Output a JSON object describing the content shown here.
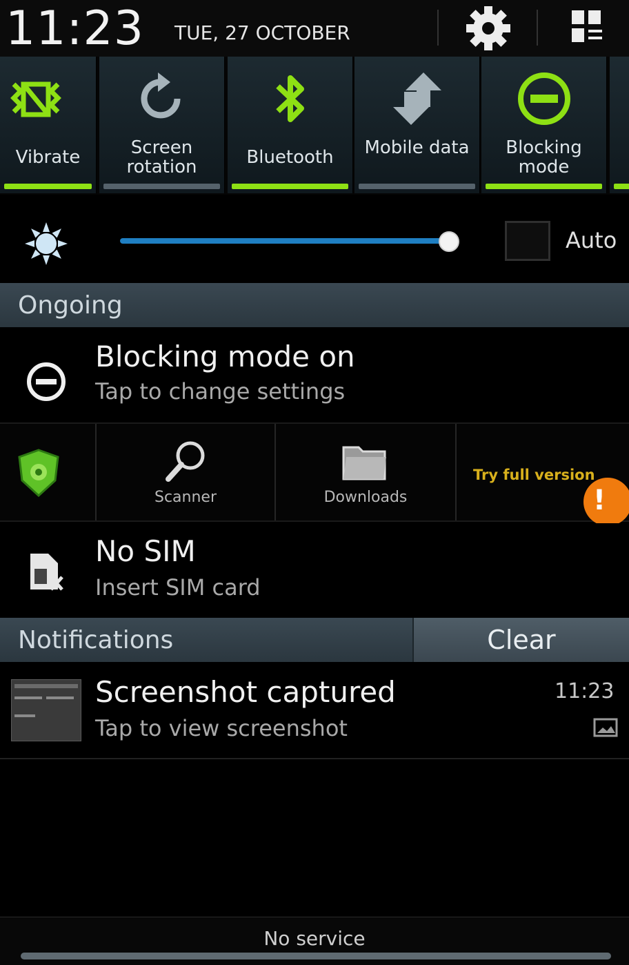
{
  "status": {
    "time": "11:23",
    "date": "TUE, 27 OCTOBER"
  },
  "toggles": [
    {
      "label": "Vibrate",
      "icon": "vibrate-icon",
      "on": true
    },
    {
      "label": "Screen rotation",
      "icon": "rotation-icon",
      "on": false
    },
    {
      "label": "Bluetooth",
      "icon": "bluetooth-icon",
      "on": true
    },
    {
      "label": "Mobile data",
      "icon": "mobile-data-icon",
      "on": false
    },
    {
      "label": "Blocking mode",
      "icon": "blocking-icon",
      "on": true
    }
  ],
  "brightness": {
    "level_fraction": 1.0,
    "auto_label": "Auto",
    "auto_checked": false
  },
  "ongoing": {
    "title": "Ongoing",
    "blocking": {
      "title": "Blocking mode on",
      "subtitle": "Tap to change settings"
    },
    "app_bar": {
      "scanner_label": "Scanner",
      "downloads_label": "Downloads",
      "promo_text": "Try full version",
      "warning_glyph": "!"
    },
    "sim": {
      "title": "No SIM",
      "subtitle": "Insert SIM card"
    }
  },
  "notifications": {
    "title": "Notifications",
    "clear_label": "Clear",
    "items": [
      {
        "title": "Screenshot captured",
        "subtitle": "Tap to view screenshot",
        "time": "11:23"
      }
    ]
  },
  "footer": {
    "carrier": "No service"
  },
  "colors": {
    "accent_on": "#8ee014",
    "slider": "#1f7fc2",
    "warning": "#f07b0e"
  }
}
